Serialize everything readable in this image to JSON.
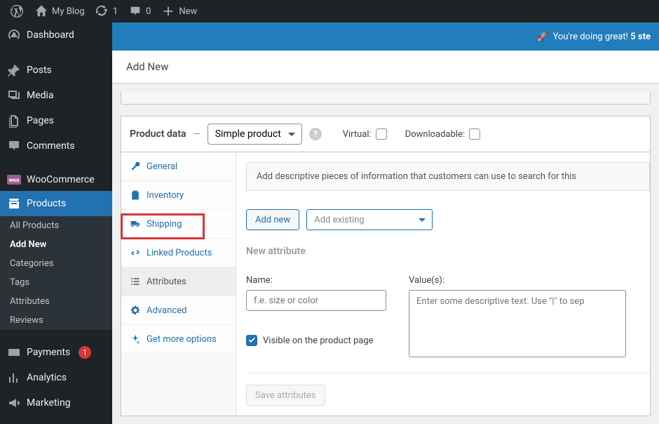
{
  "toolbar": {
    "site_name": "My Blog",
    "updates_count": "1",
    "comments_count": "0",
    "new_label": "New"
  },
  "sidebar": {
    "items": [
      {
        "label": "Dashboard"
      },
      {
        "label": "Posts"
      },
      {
        "label": "Media"
      },
      {
        "label": "Pages"
      },
      {
        "label": "Comments"
      },
      {
        "label": "WooCommerce"
      },
      {
        "label": "Products"
      },
      {
        "label": "Payments",
        "badge": "1"
      },
      {
        "label": "Analytics"
      },
      {
        "label": "Marketing"
      }
    ],
    "sub_products": [
      {
        "label": "All Products"
      },
      {
        "label": "Add New"
      },
      {
        "label": "Categories"
      },
      {
        "label": "Tags"
      },
      {
        "label": "Attributes"
      },
      {
        "label": "Reviews"
      }
    ]
  },
  "banner": {
    "emoji": "🚀",
    "text_a": "You're doing great! ",
    "text_b": "5 ste"
  },
  "page": {
    "title": "Add New"
  },
  "pdata": {
    "title": "Product data",
    "dash": "—",
    "type_value": "Simple product",
    "virtual_label": "Virtual:",
    "downloadable_label": "Downloadable:",
    "tabs": {
      "general": "General",
      "inventory": "Inventory",
      "shipping": "Shipping",
      "linked": "Linked Products",
      "attributes": "Attributes",
      "advanced": "Advanced",
      "getmore": "Get more options"
    },
    "attributes_pane": {
      "notice": "Add descriptive pieces of information that customers can use to search for this",
      "add_new": "Add new",
      "add_existing_placeholder": "Add existing",
      "new_attribute_title": "New attribute",
      "name_label": "Name:",
      "name_placeholder": "f.e. size or color",
      "values_label": "Value(s):",
      "values_placeholder": "Enter some descriptive text. Use \"|\" to sep",
      "visible_label": "Visible on the product page",
      "save_btn": "Save attributes"
    }
  }
}
